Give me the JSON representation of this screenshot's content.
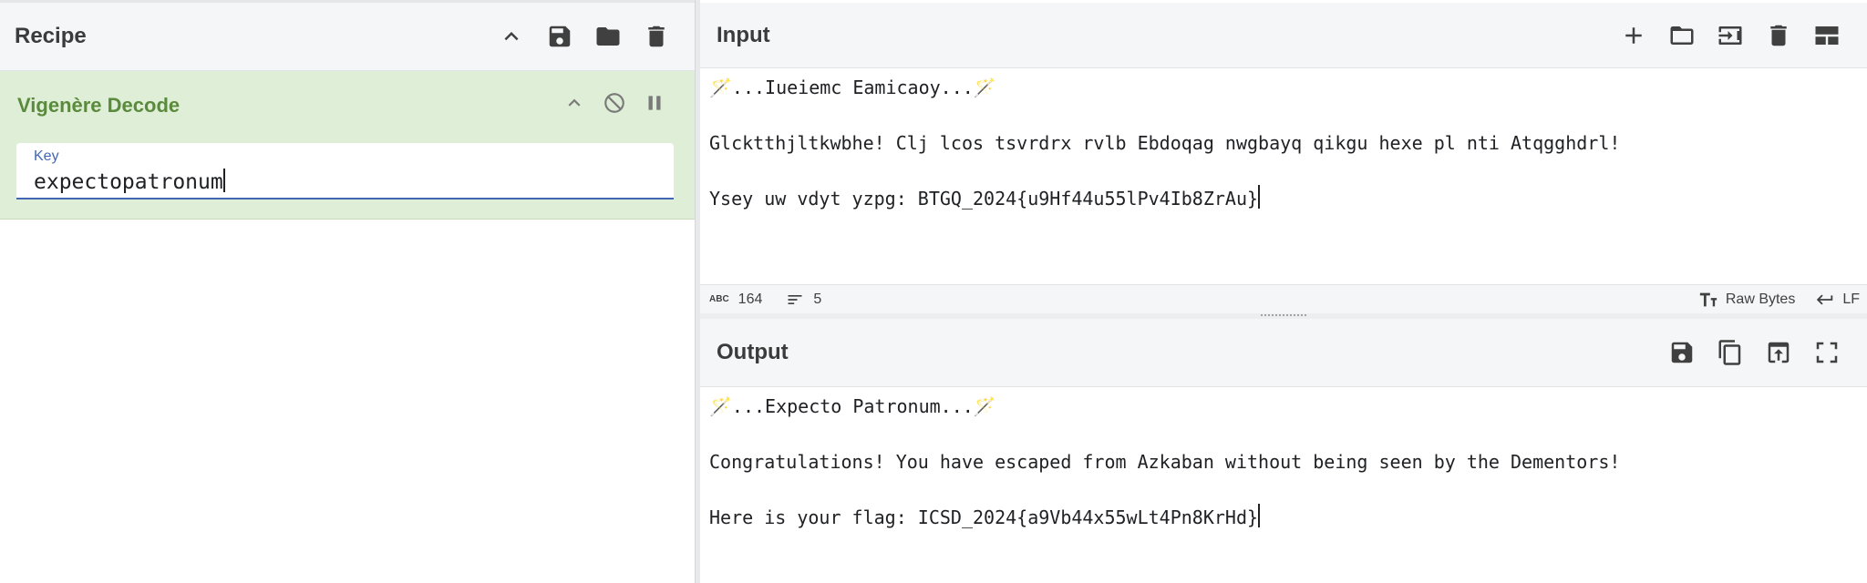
{
  "recipe": {
    "title": "Recipe",
    "icons": [
      "chevron-up-icon",
      "save-icon",
      "folder-icon",
      "trash-icon"
    ],
    "operation": {
      "name": "Vigenère Decode",
      "key_label": "Key",
      "key_value": "expectopatronum"
    }
  },
  "input": {
    "title": "Input",
    "icons": [
      "plus-icon",
      "folder-icon",
      "import-icon",
      "trash-icon",
      "layout-icon"
    ],
    "lines": [
      "🪄...Iueiemc Eamicaoy...🪄",
      "Glcktthjltkwbhe! Clj lcos tsvrdrx rvlb Ebdoqag nwgbayq qikgu hexe pl nti Atqgghdrl!",
      "Ysey uw vdyt yzpg: BTGQ_2024{u9Hf44u55lPv4Ib8ZrAu}"
    ],
    "status": {
      "chars_icon_label": "ABC",
      "chars": "164",
      "lines": "5",
      "encoding": "Raw Bytes",
      "eol": "LF"
    }
  },
  "output": {
    "title": "Output",
    "icons": [
      "save-icon",
      "copy-icon",
      "replace-input-icon",
      "fullscreen-icon"
    ],
    "lines": [
      "🪄...Expecto Patronum...🪄",
      "Congratulations! You have escaped from Azkaban without being seen by the Dementors!",
      "Here is your flag: ICSD_2024{a9Vb44x55wLt4Pn8KrHd}"
    ]
  },
  "colors": {
    "operation_bg": "#dfeed6",
    "operation_title": "#5a8a3c",
    "key_accent": "#4267b2"
  }
}
